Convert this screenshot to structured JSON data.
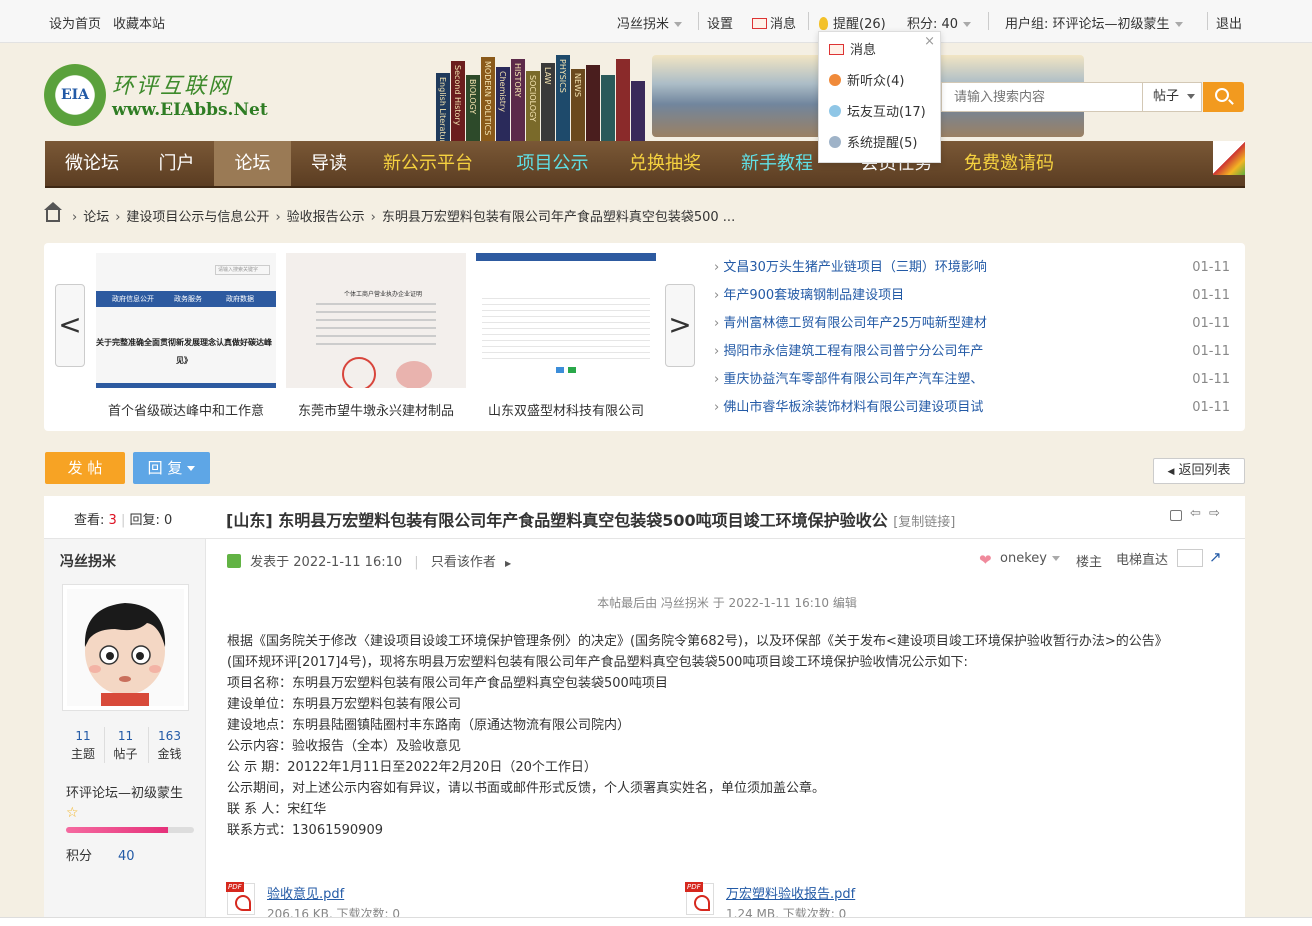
{
  "topbar": {
    "set_home": "设为首页",
    "bookmark": "收藏本站",
    "username": "冯丝拐米",
    "settings": "设置",
    "messages": "消息",
    "reminder": "提醒(26)",
    "points": "积分: 40",
    "user_group": "用户组: 环评论坛—初级蒙生",
    "logout": "退出"
  },
  "notify_menu": {
    "close": "×",
    "items": [
      "消息",
      "新听众(4)",
      "坛友互动(17)",
      "系统提醒(5)"
    ]
  },
  "logo": {
    "cn": "环评互联网",
    "en": "www.EIAbbs.Net",
    "badge": "EIA"
  },
  "book_spines": [
    "English Literature",
    "Second History",
    "BIOLOGY",
    "MODERN POLITICS",
    "Chemistry",
    "HISTORY",
    "SOCIOLOGY",
    "LAW",
    "PHYSICS",
    "NEWS"
  ],
  "search": {
    "placeholder": "请输入搜索内容",
    "type": "帖子"
  },
  "nav": [
    "微论坛",
    "门户",
    "论坛",
    "导读",
    "新公示平台",
    "项目公示",
    "兑换抽奖",
    "新手教程",
    "会员任务",
    "免费邀请码"
  ],
  "breadcrumb": [
    "论坛",
    "建设项目公示与信息公开",
    "验收报告公示",
    "东明县万宏塑料包装有限公司年产食品塑料真空包装袋500 ..."
  ],
  "slider": {
    "prev": "<",
    "next": ">",
    "captions": [
      "首个省级碳达峰中和工作意",
      "东莞市望牛墩永兴建材制品",
      "山东双盛型材科技有限公司"
    ],
    "thumb1_tabs": [
      "政府信息公开",
      "政务服务",
      "政府数据"
    ],
    "thumb1_title": "关于完整准确全面贯彻新发展理念认真做好碳达峰",
    "thumb1_title2": "见》",
    "thumb1_search": "请输入搜索关键字",
    "thumb2_title": "个体工商户营业执办企业证明"
  },
  "news": [
    {
      "title": "文昌30万头生猪产业链项目（三期）环境影响",
      "date": "01-11"
    },
    {
      "title": "年产900套玻璃钢制品建设项目",
      "date": "01-11"
    },
    {
      "title": "青州富林德工贸有限公司年产25万吨新型建材",
      "date": "01-11"
    },
    {
      "title": "揭阳市永信建筑工程有限公司普宁分公司年产",
      "date": "01-11"
    },
    {
      "title": "重庆协益汽车零部件有限公司年产汽车注塑、",
      "date": "01-11"
    },
    {
      "title": "佛山市睿华板涂装饰材料有限公司建设项目试",
      "date": "01-11"
    }
  ],
  "actions": {
    "post": "发 帖",
    "reply": "回 复",
    "back": "返回列表"
  },
  "thread": {
    "views_label": "查看:",
    "views": "3",
    "replies_label": "回复:",
    "replies": "0",
    "title": "[山东] 东明县万宏塑料包装有限公司年产食品塑料真空包装袋500吨项目竣工环境保护验收公",
    "copy_link": "[复制链接]"
  },
  "author": {
    "name": "冯丝拐米",
    "topics": "11",
    "topics_label": "主题",
    "posts": "11",
    "posts_label": "帖子",
    "money": "163",
    "money_label": "金钱",
    "group": "环评论坛—初级蒙生",
    "points_label": "积分",
    "points": "40",
    "progress": 0.8
  },
  "post": {
    "posted": "发表于 2022-1-11 16:10",
    "only_author": "只看该作者",
    "onekey": "onekey",
    "floor": "楼主",
    "elevator": "电梯直达",
    "edited": "本帖最后由 冯丝拐米 于 2022-1-11 16:10 编辑",
    "lines": [
      "根据《国务院关于修改〈建设项目设竣工环境保护管理条例〉的决定》(国务院令第682号)，以及环保部《关于发布<建设项目竣工环境保护验收暂行办法>的公告》",
      "(国环规环评[2017]4号)，现将东明县万宏塑料包装有限公司年产食品塑料真空包装袋500吨项目竣工环境保护验收情况公示如下:",
      "项目名称：东明县万宏塑料包装有限公司年产食品塑料真空包装袋500吨项目",
      "建设单位：东明县万宏塑料包装有限公司",
      "建设地点：东明县陆圈镇陆圈村丰东路南（原通达物流有限公司院内）",
      "公示内容：验收报告（全本）及验收意见",
      "公 示 期：20122年1月11日至2022年2月20日（20个工作日）",
      "公示期间，对上述公示内容如有异议，请以书面或邮件形式反馈，个人须署真实姓名，单位须加盖公章。",
      "联 系 人：宋红华",
      "联系方式：13061590909"
    ],
    "attachments": [
      {
        "name": "验收意见.pdf",
        "info": "206.16 KB, 下载次数: 0"
      },
      {
        "name": "万宏塑料验收报告.pdf",
        "info": "1.24 MB, 下载次数: 0"
      }
    ]
  },
  "colors": {
    "nav_bg": "#5b3d22",
    "accent_orange": "#f7a324",
    "reply_blue": "#5ea6e6",
    "link_blue": "#235aa6",
    "alert_red": "#d12"
  }
}
